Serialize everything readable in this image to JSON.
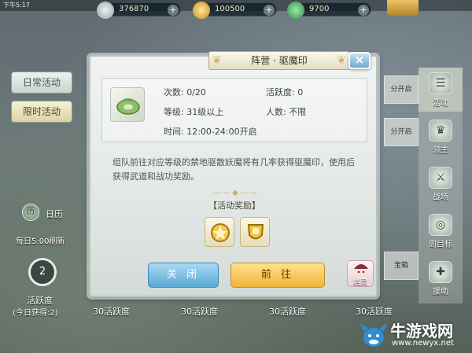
{
  "status_bar": {
    "time": "下午5:17",
    "right": ""
  },
  "currencies": [
    {
      "name": "silver-coin-icon",
      "value": "376870",
      "color": "#b9c2c6"
    },
    {
      "name": "gold-coin-icon",
      "value": "100500",
      "color": "#e9b93a"
    },
    {
      "name": "jade-icon",
      "value": "9700",
      "color": "#4fb76a"
    }
  ],
  "vip_badge": "",
  "left_panel": {
    "tabs": [
      {
        "label": "日常活动"
      },
      {
        "label": "限时活动"
      }
    ],
    "calendar_icon": "历",
    "calendar_label": "日历",
    "daily_refresh": "每日5:00刷新",
    "ring_value": "2",
    "activity_label": "活跃度",
    "today_gain": "(今日获得:2)"
  },
  "right_bar": {
    "items": [
      {
        "label": "活动",
        "icon": "activity-icon"
      },
      {
        "label": "领主",
        "icon": "lord-icon"
      },
      {
        "label": "战场",
        "icon": "battlefield-icon"
      },
      {
        "label": "周目标",
        "icon": "weekly-goal-icon"
      },
      {
        "label": "援助",
        "icon": "aid-icon"
      }
    ]
  },
  "background_cards": {
    "open_labels": [
      "分开启",
      "分开启"
    ],
    "box_label": "宝箱"
  },
  "bottom_labels": [
    "30活跃度",
    "30活跃度",
    "30活跃度",
    "30活跃度"
  ],
  "dialog": {
    "title": "阵营 · 驱魔印",
    "close_x": "×",
    "info": {
      "count": "次数: 0/20",
      "activity": "活跃度: 0",
      "level": "等级: 31级以上",
      "players": "人数: 不限",
      "time": "时间: 12:00-24:00开启"
    },
    "description": "组队前往对应等级的禁地驱散妖魔将有几率获得驱魔印，使用后获得武道和战功奖励。",
    "reward_title": "【活动奖励】",
    "rewards": [
      {
        "name": "martial-reward-icon"
      },
      {
        "name": "merit-reward-icon"
      }
    ],
    "buttons": {
      "close": "关 闭",
      "go": "前 往"
    }
  },
  "fairy": {
    "label": "精灵"
  },
  "watermark": {
    "title": "牛游戏网",
    "url": "www.newyx.net"
  }
}
